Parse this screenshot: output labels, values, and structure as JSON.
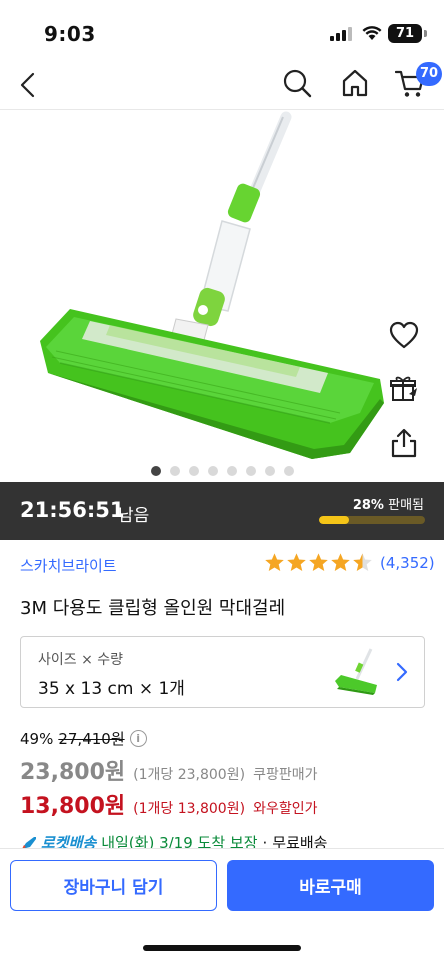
{
  "status_bar": {
    "time": "9:03",
    "battery": "71"
  },
  "nav": {
    "cart_count": "70"
  },
  "gallery": {
    "dot_count": 8,
    "active_index": 0
  },
  "deal": {
    "timer": "21:56:51",
    "remaining_label": "남음",
    "sold_percent": "28%",
    "sold_label": "판매됨",
    "sold_fraction": 0.28
  },
  "product": {
    "brand": "스카치브라이트",
    "rating": 4.5,
    "review_count": "(4,352)",
    "title": "3M 다용도 클립형 올인원 막대걸레"
  },
  "option": {
    "label": "사이즈 × 수량",
    "value": "35 x 13 cm × 1개"
  },
  "pricing": {
    "discount_percent": "49%",
    "original_price": "27,410원",
    "info_icon": "i",
    "price": "23,800원",
    "price_unit": "(1개당 23,800원)",
    "price_label": "쿠팡판매가",
    "wow_price": "13,800원",
    "wow_unit": "(1개당 13,800원)",
    "wow_label": "와우할인가"
  },
  "delivery": {
    "badge": "로켓배송",
    "date": "내일(화) 3/19 도착 보장",
    "separator": "·",
    "fee": "무료배송"
  },
  "actions": {
    "cart_button": "장바구니 담기",
    "buy_button": "바로구매"
  },
  "colors": {
    "accent": "#346aff",
    "wow_red": "#c4121f",
    "mop_green": "#4cc92a",
    "deal_bar": "#333333",
    "progress": "#f5c518"
  },
  "icons": [
    "back-arrow-icon",
    "search-icon",
    "home-icon",
    "cart-icon",
    "heart-icon",
    "gift-share-icon",
    "share-icon",
    "star-icon",
    "info-icon",
    "rocket-icon",
    "chevron-right-icon"
  ]
}
